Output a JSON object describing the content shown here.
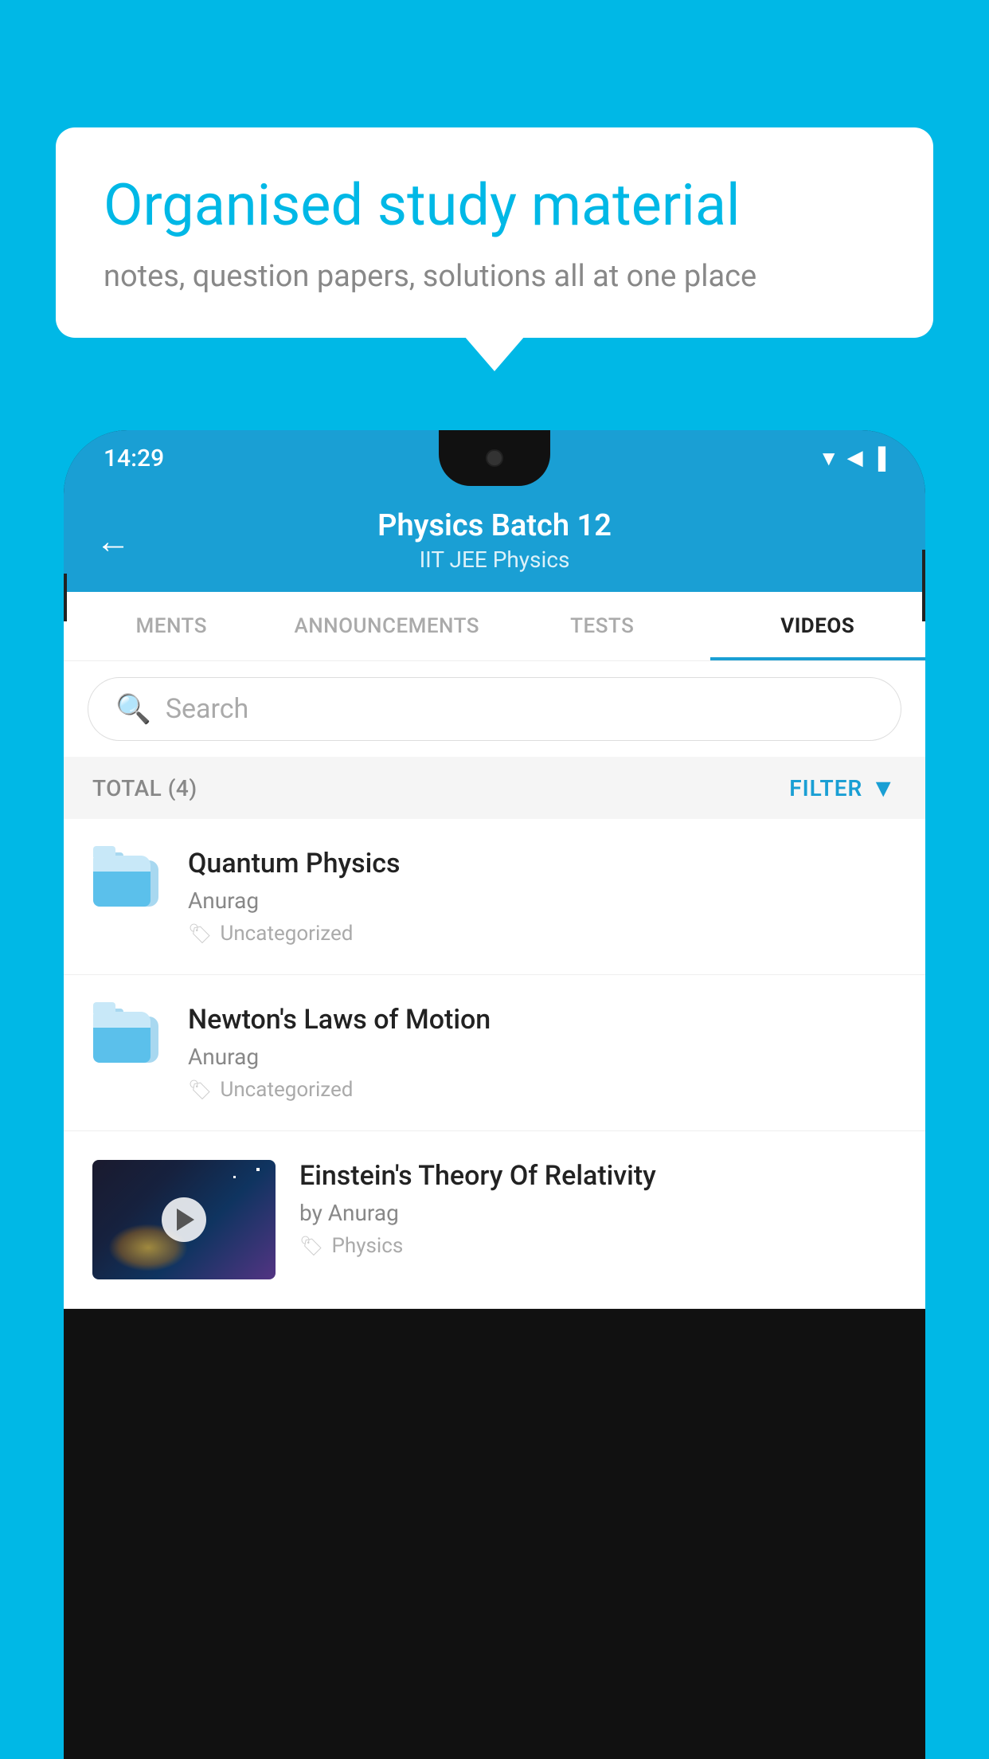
{
  "background": {
    "color": "#00b8e6"
  },
  "speech_bubble": {
    "title": "Organised study material",
    "subtitle": "notes, question papers, solutions all at one place"
  },
  "phone": {
    "status_bar": {
      "time": "14:29",
      "icons": [
        "wifi",
        "signal",
        "battery"
      ]
    },
    "app_header": {
      "back_label": "←",
      "title": "Physics Batch 12",
      "subtitle": "IIT JEE   Physics"
    },
    "tabs": [
      {
        "label": "MENTS",
        "active": false
      },
      {
        "label": "ANNOUNCEMENTS",
        "active": false
      },
      {
        "label": "TESTS",
        "active": false
      },
      {
        "label": "VIDEOS",
        "active": true
      }
    ],
    "search": {
      "placeholder": "Search"
    },
    "filter_bar": {
      "total_label": "TOTAL (4)",
      "filter_label": "FILTER"
    },
    "video_items": [
      {
        "title": "Quantum Physics",
        "author": "Anurag",
        "tag": "Uncategorized",
        "has_thumbnail": false
      },
      {
        "title": "Newton's Laws of Motion",
        "author": "Anurag",
        "tag": "Uncategorized",
        "has_thumbnail": false
      },
      {
        "title": "Einstein's Theory Of Relativity",
        "author": "by Anurag",
        "tag": "Physics",
        "has_thumbnail": true
      }
    ]
  }
}
